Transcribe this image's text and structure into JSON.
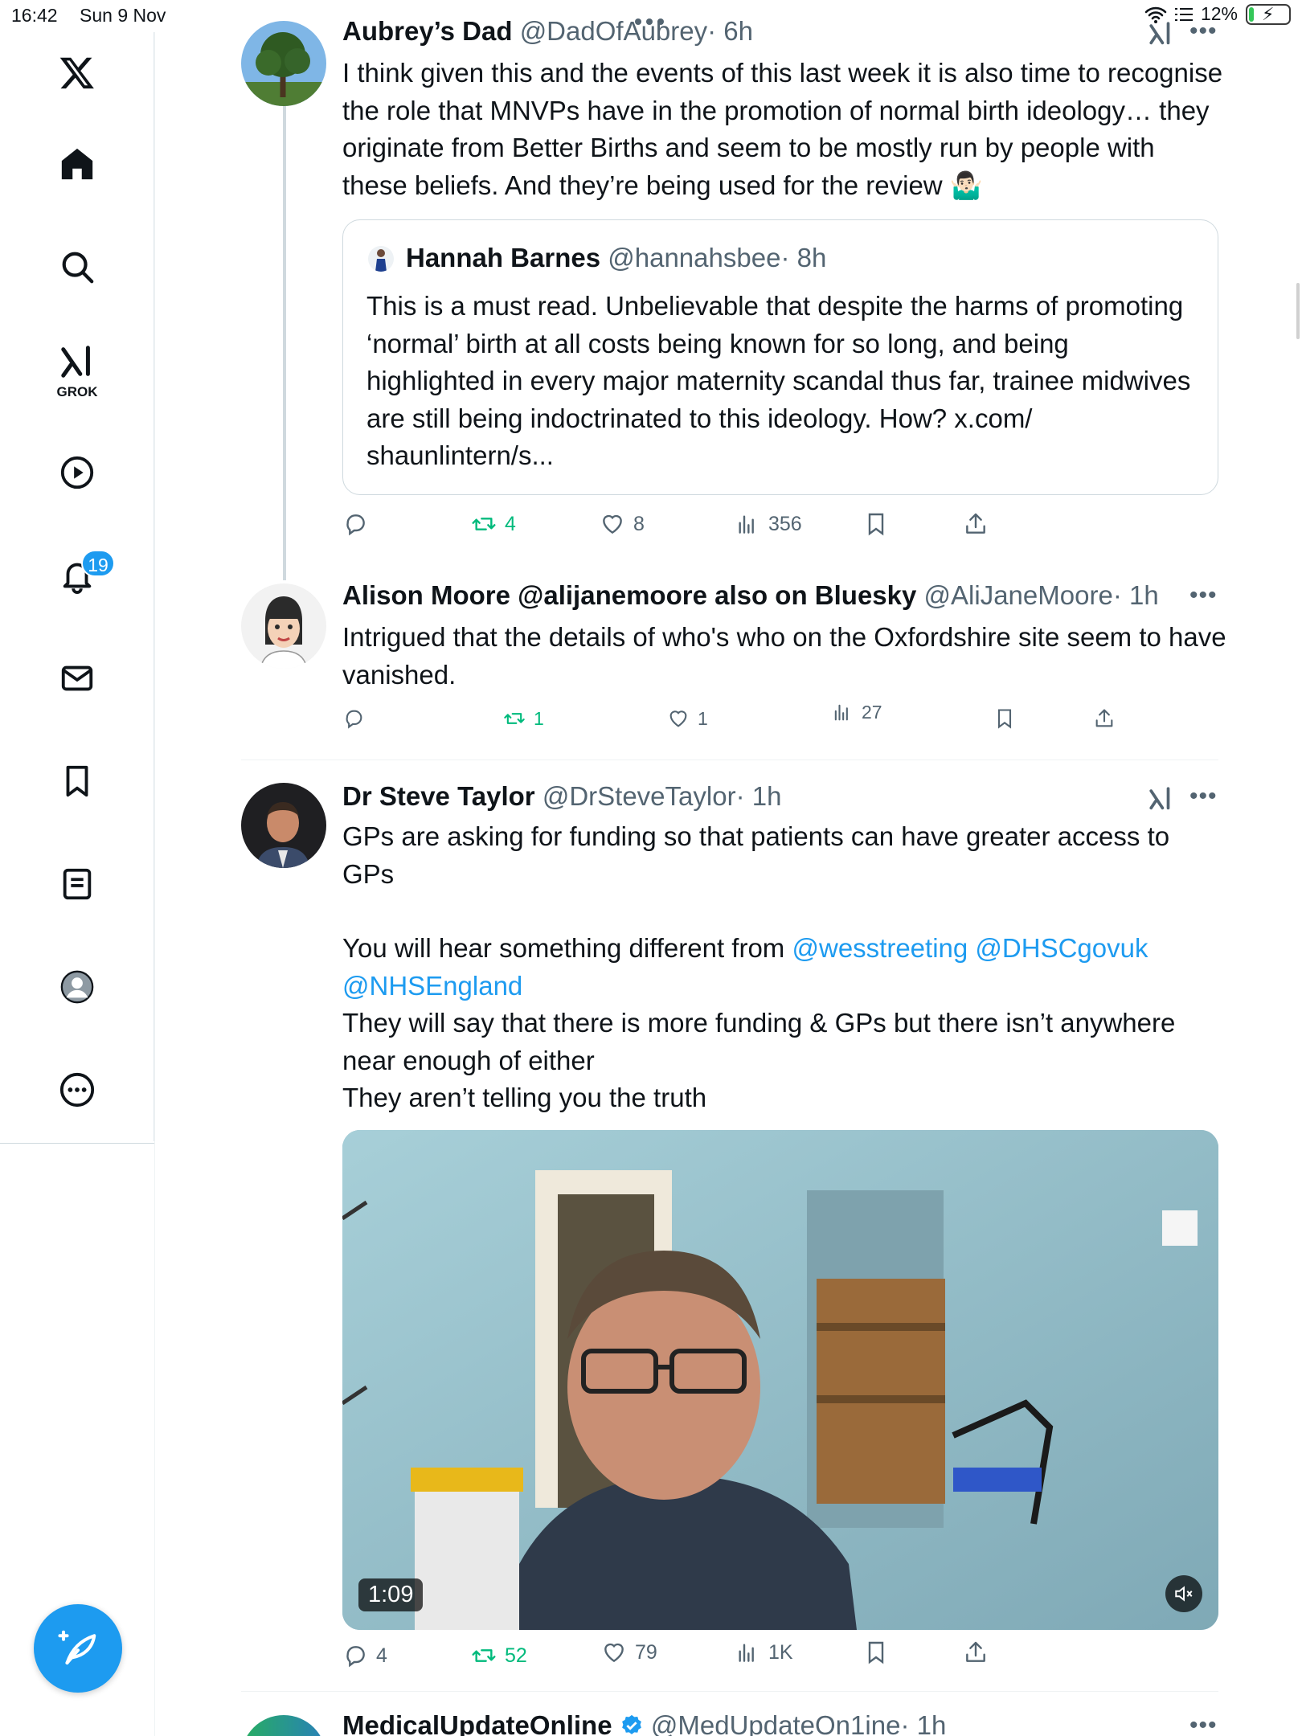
{
  "status_bar": {
    "time": "16:42",
    "date": "Sun 9 Nov",
    "battery": "12%",
    "battery_level": 0.12
  },
  "sidebar": {
    "items": [
      {
        "icon": "x-logo-icon"
      },
      {
        "icon": "home-icon"
      },
      {
        "icon": "search-icon"
      },
      {
        "icon": "grok-icon",
        "label": "GROK"
      },
      {
        "icon": "video-icon"
      },
      {
        "icon": "notifications-icon",
        "badge": "19"
      },
      {
        "icon": "messages-icon"
      },
      {
        "icon": "bookmarks-icon"
      },
      {
        "icon": "lists-icon"
      },
      {
        "icon": "profile-icon"
      },
      {
        "icon": "more-icon"
      }
    ],
    "compose_icon": "compose-icon"
  },
  "feed": {
    "tweets": [
      {
        "name": "Aubrey’s Dad",
        "handle": "@DadOfAubrey",
        "time": "· 6h",
        "text": "I think given this and the events of this last week it is also time to recognise the role that MNVPs have in the promotion of normal birth ideology… they originate from Better Births and seem to be mostly run by people with these beliefs. And they’re being used for the review 🤷🏻‍♂️",
        "quote": {
          "name": "Hannah Barnes",
          "handle": "@hannahsbee",
          "time": "· 8h",
          "text": "This is a must read. Unbelievable that despite the harms of promoting ‘normal’ birth at all costs being known for so long, and being highlighted in every major maternity scandal thus far, trainee midwives are still being indoctrinated to this ideology. How? x.com/ shaunlintern/s..."
        },
        "stats": {
          "replies": "",
          "reposts": "4",
          "likes": "8",
          "views": "356"
        }
      },
      {
        "name": "Alison Moore @alijanemoore also on Bluesky",
        "handle": "@AliJaneMoore",
        "time": "· 1h",
        "text": "Intrigued that the details of who's who on the Oxfordshire site seem to have vanished.",
        "stats": {
          "replies": "",
          "reposts": "1",
          "likes": "1",
          "views": "27"
        }
      },
      {
        "name": "Dr Steve Taylor",
        "handle": "@DrSteveTaylor",
        "time": "· 1h",
        "text_line1": "GPs are asking for funding so that patients can have greater access to GPs",
        "text_line2_prefix": "You will hear something different from ",
        "mention1": "@wesstreeting",
        "mention2": "@DHSCgovuk",
        "mention3": "@NHSEngland",
        "text_line3": "They will say that there is more funding & GPs but there isn’t anywhere near enough of either",
        "text_line4": "They aren’t telling you the truth",
        "video_duration": "1:09",
        "stats": {
          "replies": "4",
          "reposts": "52",
          "likes": "79",
          "views": "1K"
        }
      },
      {
        "name": "MedicalUpdateOnline",
        "handle": "@MedUpdateOn1ine",
        "time": "· 1h"
      }
    ]
  }
}
